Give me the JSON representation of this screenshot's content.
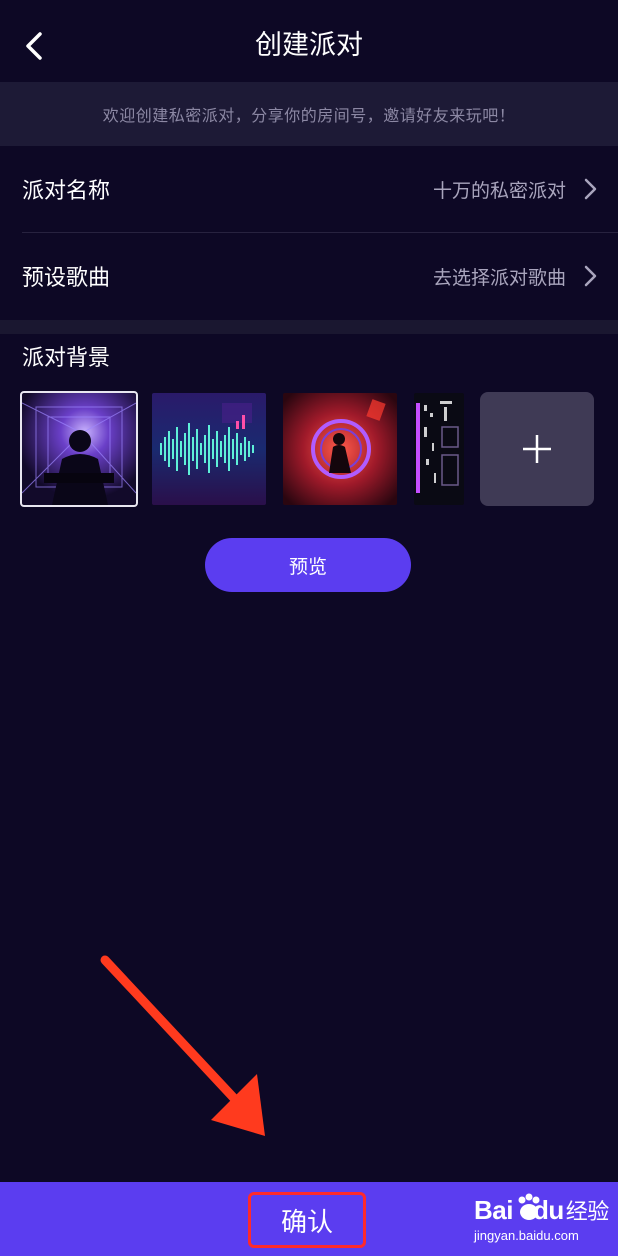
{
  "header": {
    "title": "创建派对",
    "back_icon": "chevron-left-icon"
  },
  "banner": {
    "text": "欢迎创建私密派对，分享你的房间号，邀请好友来玩吧！"
  },
  "form": {
    "party_name": {
      "label": "派对名称",
      "value": "十万的私密派对"
    },
    "preset_song": {
      "label": "预设歌曲",
      "value": "去选择派对歌曲"
    },
    "background": {
      "label": "派对背景",
      "selected_index": 0,
      "thumbnails": [
        "dj-silhouette-thumb",
        "sound-wave-thumb",
        "red-club-thumb",
        "neon-panel-thumb"
      ],
      "add_icon": "plus-icon"
    }
  },
  "preview_button": {
    "label": "预览"
  },
  "confirm_button": {
    "label": "确认"
  },
  "watermark": {
    "brand": "Bai",
    "brand2": "du",
    "suffix": "经验",
    "url": "jingyan.baidu.com"
  },
  "colors": {
    "background": "#0d0825",
    "banner": "#1d1a36",
    "accent": "#5b3df0",
    "highlight_border": "#ff2a2a",
    "annotation_arrow": "#ff3a1e"
  }
}
